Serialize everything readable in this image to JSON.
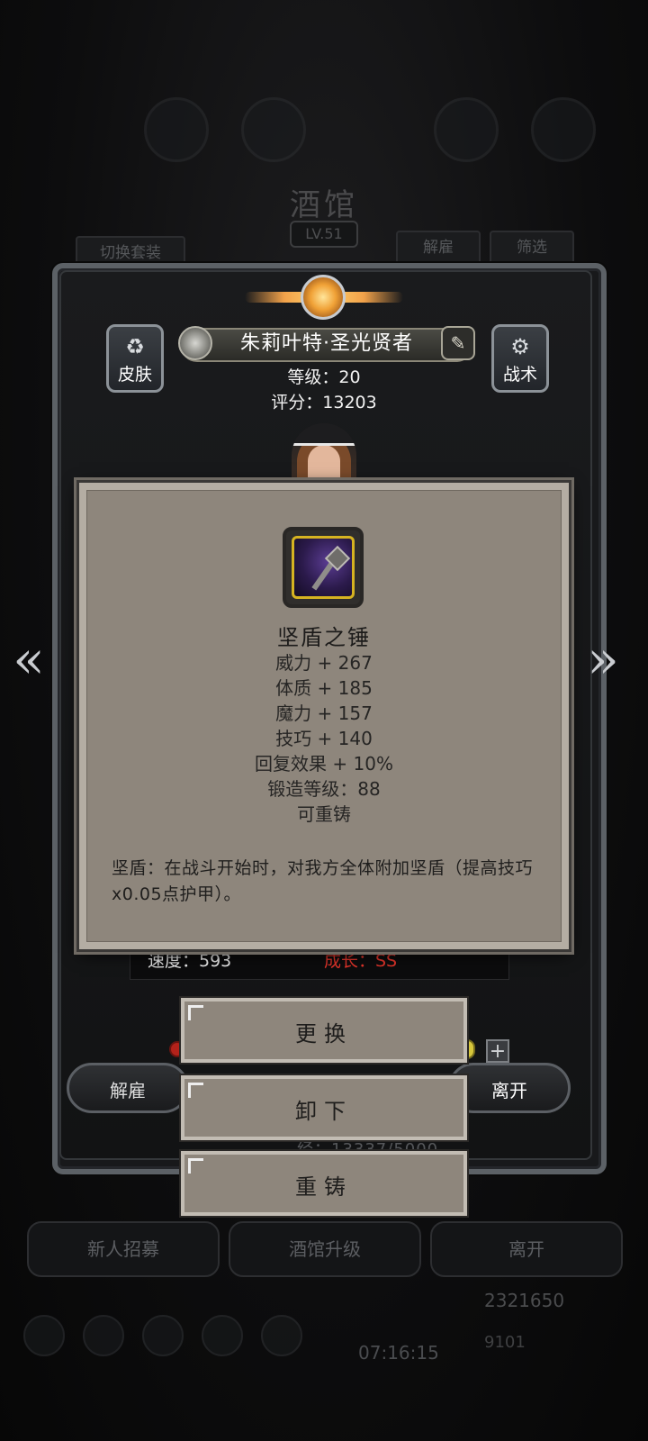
{
  "background": {
    "title": "酒馆",
    "level": "LV.51",
    "switch_outfit": "切换套装",
    "dismiss_tab": "解雇",
    "filter_tab": "筛选",
    "footer_buttons": [
      "新人招募",
      "酒馆升级",
      "离开"
    ],
    "time": "07:16:15",
    "coins": "2321650",
    "gems": "9101",
    "exp_text": "经：13337/5000"
  },
  "hero": {
    "name": "朱莉叶特·圣光贤者",
    "level_text": "等级：20",
    "score_text": "评分：13203",
    "skin_label": "皮肤",
    "tactics_label": "战术",
    "speed_text": "速度：593",
    "growth_text": "成长：SS",
    "dismiss_label": "解雇",
    "leave_label": "离开"
  },
  "item": {
    "name": "坚盾之锤",
    "stats": [
      "威力 + 267",
      "体质 + 185",
      "魔力 + 157",
      "技巧 + 140",
      "回复效果 + 10%",
      "锻造等级：88",
      "可重铸"
    ],
    "description": "坚盾：在战斗开始时，对我方全体附加坚盾（提高技巧x0.05点护甲）。",
    "icon": "mace-icon"
  },
  "actions": {
    "replace": "更换",
    "unequip": "卸下",
    "reforge": "重铸"
  },
  "nav": {
    "prev": "«",
    "next": "»"
  },
  "colors": {
    "tooltip_bg": "#8e867c",
    "growth_red": "#e5352b",
    "item_border_gold": "#d6b321"
  }
}
